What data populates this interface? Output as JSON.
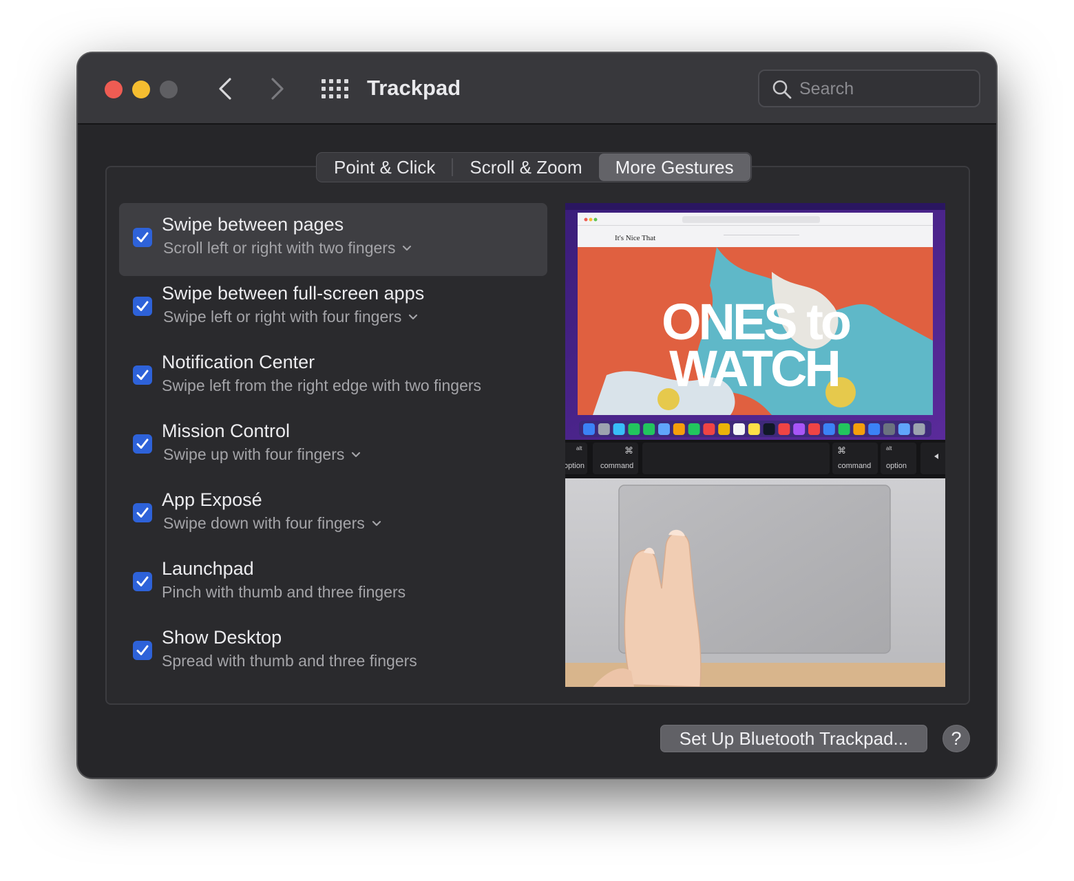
{
  "window": {
    "title": "Trackpad",
    "search_placeholder": "Search"
  },
  "tabs": [
    {
      "label": "Point & Click",
      "active": false
    },
    {
      "label": "Scroll & Zoom",
      "active": false
    },
    {
      "label": "More Gestures",
      "active": true
    }
  ],
  "gestures": [
    {
      "title": "Swipe between pages",
      "subtitle": "Scroll left or right with two fingers",
      "checked": true,
      "has_popup": true,
      "selected": true
    },
    {
      "title": "Swipe between full-screen apps",
      "subtitle": "Swipe left or right with four fingers",
      "checked": true,
      "has_popup": true,
      "selected": false
    },
    {
      "title": "Notification Center",
      "subtitle": "Swipe left from the right edge with two fingers",
      "checked": true,
      "has_popup": false,
      "selected": false
    },
    {
      "title": "Mission Control",
      "subtitle": "Swipe up with four fingers",
      "checked": true,
      "has_popup": true,
      "selected": false
    },
    {
      "title": "App Exposé",
      "subtitle": "Swipe down with four fingers",
      "checked": true,
      "has_popup": true,
      "selected": false
    },
    {
      "title": "Launchpad",
      "subtitle": "Pinch with thumb and three fingers",
      "checked": true,
      "has_popup": false,
      "selected": false
    },
    {
      "title": "Show Desktop",
      "subtitle": "Spread with thumb and three fingers",
      "checked": true,
      "has_popup": false,
      "selected": false
    }
  ],
  "preview": {
    "site_name": "It's Nice That",
    "headline_line1": "ONES to",
    "headline_line2": "WATCH",
    "keys": {
      "left_option": "option",
      "left_command": "command",
      "right_command": "command",
      "right_option": "option",
      "alt": "alt",
      "cmd_symbol": "⌘"
    }
  },
  "footer": {
    "setup_button": "Set Up Bluetooth Trackpad...",
    "help_button": "?"
  },
  "colors": {
    "window_bg": "#262629",
    "titlebar_bg": "#38383c",
    "checkbox_blue": "#2e62d9",
    "close": "#ee5c53",
    "minimize": "#f5bd30",
    "maximize_disabled": "#5f5f63"
  }
}
